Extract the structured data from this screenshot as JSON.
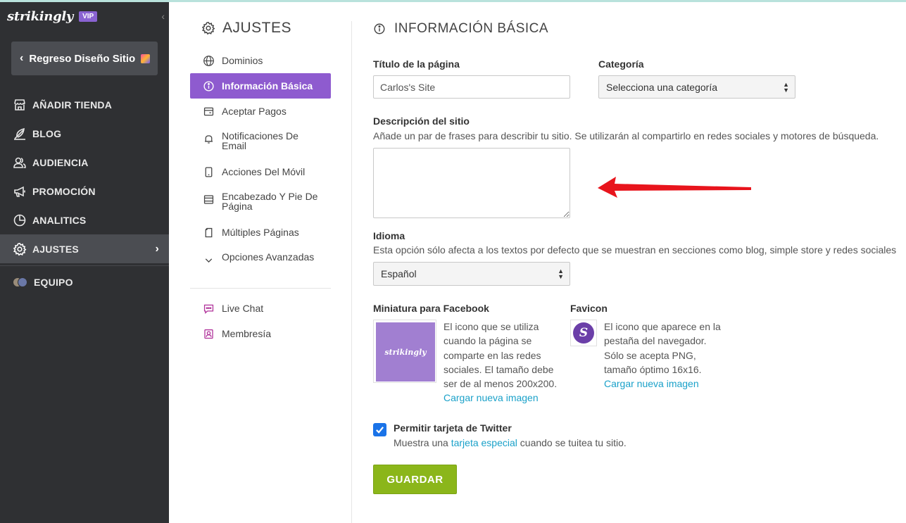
{
  "sidebar": {
    "logo": "strikingly",
    "badge": "VIP",
    "back_label": "Regreso Diseño Sitio",
    "items": [
      {
        "label": "AÑADIR TIENDA",
        "icon": "store-icon"
      },
      {
        "label": "BLOG",
        "icon": "feather-icon"
      },
      {
        "label": "AUDIENCIA",
        "icon": "users-icon"
      },
      {
        "label": "PROMOCIÓN",
        "icon": "megaphone-icon"
      },
      {
        "label": "ANALITICS",
        "icon": "pie-chart-icon"
      },
      {
        "label": "AJUSTES",
        "icon": "gear-icon",
        "active": true
      },
      {
        "label": "EQUIPO",
        "icon": "team-avatars-icon"
      }
    ]
  },
  "settings": {
    "title": "AJUSTES",
    "menu": [
      {
        "label": "Dominios",
        "icon": "globe-icon"
      },
      {
        "label": "Información Básica",
        "icon": "info-icon",
        "active": true
      },
      {
        "label": "Aceptar Pagos",
        "icon": "card-icon"
      },
      {
        "label": "Notificaciones De Email",
        "icon": "bell-icon"
      },
      {
        "label": "Acciones Del Móvil",
        "icon": "mobile-icon"
      },
      {
        "label": "Encabezado Y Pie De Página",
        "icon": "layout-icon"
      },
      {
        "label": "Múltiples Páginas",
        "icon": "pages-icon"
      },
      {
        "label": "Opciones Avanzadas",
        "icon": "chevron-down-icon"
      },
      {
        "label": "Live Chat",
        "icon": "chat-icon"
      },
      {
        "label": "Membresía",
        "icon": "member-icon"
      }
    ]
  },
  "form": {
    "title": "INFORMACIÓN BÁSICA",
    "page_title_label": "Título de la página",
    "page_title_value": "Carlos's Site",
    "category_label": "Categoría",
    "category_value": "Selecciona una categoría",
    "description_label": "Descripción del sitio",
    "description_help": "Añade un par de frases para describir tu sitio. Se utilizarán al compartirlo en redes sociales y motores de búsqueda.",
    "language_label": "Idioma",
    "language_help": "Esta opción sólo afecta a los textos por defecto que se muestran en secciones como blog, simple store y redes sociales",
    "language_value": "Español",
    "fb_label": "Miniatura para Facebook",
    "fb_thumb_text": "strikingly",
    "fb_desc_lines": [
      "El icono que se utiliza",
      "cuando la página se",
      "comparte en las redes",
      "sociales. El tamaño debe",
      "ser de al menos 200x200."
    ],
    "fb_link": "Cargar nueva imagen",
    "favicon_label": "Favicon",
    "favicon_letter": "S",
    "favicon_desc_lines": [
      "El icono que aparece en la",
      "pestaña del navegador.",
      "Sólo se acepta PNG,",
      "tamaño óptimo 16x16."
    ],
    "favicon_link": "Cargar nueva imagen",
    "twitter_label": "Permitir tarjeta de Twitter",
    "twitter_help_before": "Muestra una ",
    "twitter_help_link": "tarjeta especial",
    "twitter_help_after": " cuando se tuitea tu sitio.",
    "save_label": "GUARDAR"
  },
  "colors": {
    "sidebar_bg": "#2f3033",
    "active_menu": "#8e5bcf",
    "save_button": "#8bb61a",
    "link": "#1aa1c9",
    "annotation_arrow": "#e8141c"
  }
}
